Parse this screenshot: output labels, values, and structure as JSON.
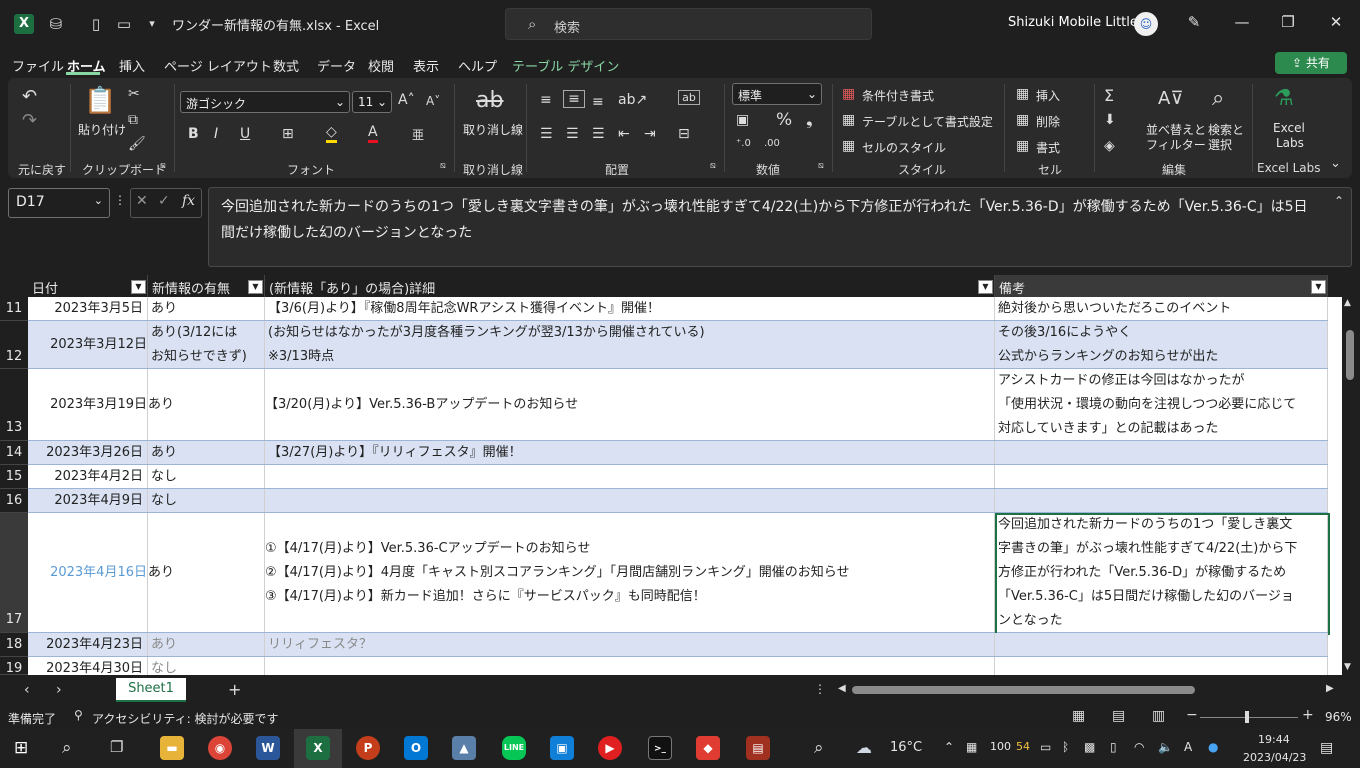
{
  "title_bar": {
    "doc_title": "ワンダー新情報の有無.xlsx  -  Excel",
    "search_placeholder": "検索",
    "user_name": "Shizuki Mobile Little"
  },
  "menu": [
    "ファイル",
    "ホーム",
    "挿入",
    "ページ レイアウト",
    "数式",
    "データ",
    "校閲",
    "表示",
    "ヘルプ",
    "テーブル デザイン"
  ],
  "share_label": "共有",
  "ribbon": {
    "undo_label": "元に戻す",
    "paste_label": "貼り付け",
    "clipboard_label": "クリップボード",
    "font_name": "游ゴシック",
    "font_size": "11",
    "font_label": "フォント",
    "strike_label": "取り消し線",
    "strike_group": "取り消し線",
    "align_label": "配置",
    "number_format": "標準",
    "number_label": "数値",
    "cond_format": "条件付き書式",
    "table_format": "テーブルとして書式設定",
    "cell_style": "セルのスタイル",
    "style_label": "スタイル",
    "insert": "挿入",
    "delete": "削除",
    "format": "書式",
    "cell_label": "セル",
    "sort_filter_1": "並べ替えと",
    "sort_filter_2": "フィルター",
    "find_select_1": "検索と",
    "find_select_2": "選択",
    "edit_label": "編集",
    "labs_1": "Excel",
    "labs_2": "Labs",
    "labs_group": "Excel Labs"
  },
  "formula_bar": {
    "name_box": "D17",
    "fx": "fx",
    "content": "今回追加された新カードのうちの1つ「愛しき裏文字書きの筆」がぶっ壊れ性能すぎて4/22(土)から下方修正が行われた「Ver.5.36-D」が稼働するため「Ver.5.36-C」は5日間だけ稼働した幻のバージョンとなった"
  },
  "table": {
    "headers": [
      "日付",
      "新情報の有無",
      "(新情報「あり」の場合)詳細",
      "備考"
    ],
    "rows": [
      {
        "num": "11",
        "date": "2023年3月5日",
        "has": [
          "あり"
        ],
        "detail": [
          "【3/6(月)より】『稼働8周年記念WRアシスト獲得イベント』開催！"
        ],
        "note": [
          "絶対後から思いついただろこのイベント"
        ]
      },
      {
        "num": "12",
        "date": "2023年3月12日",
        "has": [
          "あり(3/12には",
          "お知らせできず)"
        ],
        "detail": [
          "(お知らせはなかったが3月度各種ランキングが翌3/13から開催されている)",
          "※3/13時点"
        ],
        "note": [
          "その後3/16にようやく",
          "公式からランキングのお知らせが出た"
        ]
      },
      {
        "num": "13",
        "date": "2023年3月19日",
        "has": [
          "あり"
        ],
        "detail": [
          "【3/20(月)より】Ver.5.36-Bアップデートのお知らせ"
        ],
        "note": [
          "アシストカードの修正は今回はなかったが",
          "「使用状況・環境の動向を注視しつつ必要に応じて",
          "対応していきます」との記載はあった"
        ]
      },
      {
        "num": "14",
        "date": "2023年3月26日",
        "has": [
          "あり"
        ],
        "detail": [
          "【3/27(月)より】『リリィフェスタ』開催！"
        ],
        "note": []
      },
      {
        "num": "15",
        "date": "2023年4月2日",
        "has": [
          "なし"
        ],
        "detail": [],
        "note": []
      },
      {
        "num": "16",
        "date": "2023年4月9日",
        "has": [
          "なし"
        ],
        "detail": [],
        "note": []
      },
      {
        "num": "17",
        "date": "2023年4月16日",
        "has": [
          "あり"
        ],
        "detail": [
          "①【4/17(月)より】Ver.5.36-Cアップデートのお知らせ",
          "②【4/17(月)より】4月度「キャスト別スコアランキング」「月間店舗別ランキング」開催のお知らせ",
          "③【4/17(月)より】新カード追加！さらに『サービスパック』も同時配信！"
        ],
        "note": [
          "今回追加された新カードのうちの1つ「愛しき裏文",
          "字書きの筆」がぶっ壊れ性能すぎて4/22(土)から下",
          "方修正が行われた「Ver.5.36-D」が稼働するため",
          "「Ver.5.36-C」は5日間だけ稼働した幻のバージョ",
          "ンとなった"
        ]
      },
      {
        "num": "18",
        "date": "2023年4月23日",
        "has": [
          "あり"
        ],
        "detail": [
          "リリィフェスタ？"
        ],
        "note": []
      },
      {
        "num": "19",
        "date": "2023年4月30日",
        "has": [
          "なし"
        ],
        "detail": [],
        "note": []
      }
    ]
  },
  "sheet_tab": "Sheet1",
  "status": {
    "ready": "準備完了",
    "accessibility": "アクセシビリティ: 検討が必要です",
    "zoom": "96%"
  },
  "taskbar": {
    "temperature": "16°C",
    "time": "19:44",
    "date": "2023/04/23",
    "tray_num1": "100",
    "tray_num2": "54"
  }
}
